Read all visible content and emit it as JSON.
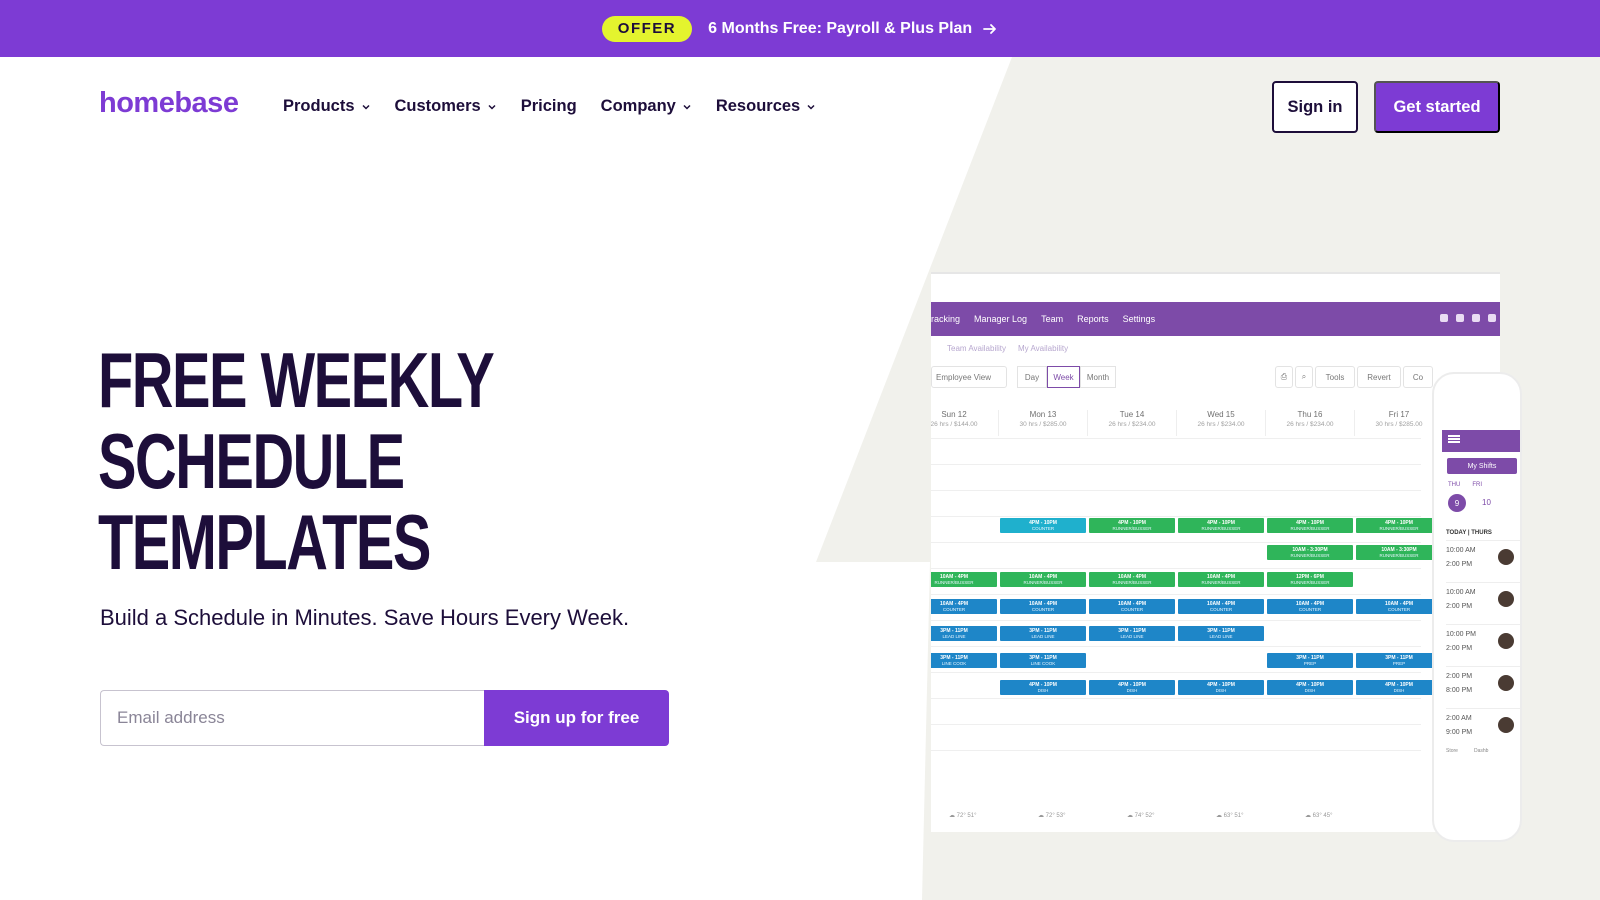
{
  "banner": {
    "offer_label": "OFFER",
    "text": "6 Months Free: Payroll & Plus Plan"
  },
  "nav": {
    "logo": "homebase",
    "items": [
      {
        "label": "Products",
        "dropdown": true
      },
      {
        "label": "Customers",
        "dropdown": true
      },
      {
        "label": "Pricing",
        "dropdown": false
      },
      {
        "label": "Company",
        "dropdown": true
      },
      {
        "label": "Resources",
        "dropdown": true
      }
    ],
    "signin_label": "Sign in",
    "get_started_label": "Get started"
  },
  "hero": {
    "title_lines": [
      "FREE WEEKLY",
      "SCHEDULE",
      "TEMPLATES"
    ],
    "subtitle": "Build a Schedule in Minutes. Save Hours Every Week.",
    "email_placeholder": "Email address",
    "signup_label": "Sign up for free"
  },
  "mock": {
    "app_tabs": [
      "racking",
      "Manager Log",
      "Team",
      "Reports",
      "Settings"
    ],
    "sub_tabs": [
      "Team Availability",
      "My Availability"
    ],
    "view_select": "Employee View",
    "view_buttons": [
      "Day",
      "Week",
      "Month"
    ],
    "toolbar_right": [
      "Tools",
      "Revert",
      "Co"
    ],
    "days": [
      {
        "name": "Sun 12",
        "hrs": "26 hrs / $144.00"
      },
      {
        "name": "Mon 13",
        "hrs": "30 hrs / $285.00"
      },
      {
        "name": "Tue 14",
        "hrs": "26 hrs / $234.00"
      },
      {
        "name": "Wed 15",
        "hrs": "26 hrs / $234.00"
      },
      {
        "name": "Thu 16",
        "hrs": "26 hrs / $234.00"
      },
      {
        "name": "Fri 17",
        "hrs": "30 hrs / $285.00"
      }
    ],
    "shifts": [
      {
        "day": 1,
        "row": 0,
        "color": "teal",
        "time": "4PM - 10PM",
        "role": "COUNTER"
      },
      {
        "day": 2,
        "row": 0,
        "color": "green",
        "time": "4PM - 10PM",
        "role": "RUNNER/BUSSER"
      },
      {
        "day": 3,
        "row": 0,
        "color": "green",
        "time": "4PM - 10PM",
        "role": "RUNNER/BUSSER"
      },
      {
        "day": 4,
        "row": 0,
        "color": "green",
        "time": "4PM - 10PM",
        "role": "RUNNER/BUSSER"
      },
      {
        "day": 5,
        "row": 0,
        "color": "green",
        "time": "4PM - 10PM",
        "role": "RUNNER/BUSSER"
      },
      {
        "day": 4,
        "row": 1,
        "color": "green",
        "time": "10AM - 3:30PM",
        "role": "RUNNER/BUSSER"
      },
      {
        "day": 5,
        "row": 1,
        "color": "green",
        "time": "10AM - 3:30PM",
        "role": "RUNNER/BUSSER"
      },
      {
        "day": 0,
        "row": 2,
        "color": "green",
        "time": "10AM - 4PM",
        "role": "RUNNER/BUSSER"
      },
      {
        "day": 1,
        "row": 2,
        "color": "green",
        "time": "10AM - 4PM",
        "role": "RUNNER/BUSSER"
      },
      {
        "day": 2,
        "row": 2,
        "color": "green",
        "time": "10AM - 4PM",
        "role": "RUNNER/BUSSER"
      },
      {
        "day": 3,
        "row": 2,
        "color": "green",
        "time": "10AM - 4PM",
        "role": "RUNNER/BUSSER"
      },
      {
        "day": 4,
        "row": 2,
        "color": "green",
        "time": "12PM - 6PM",
        "role": "RUNNER/BUSSER"
      },
      {
        "day": 0,
        "row": 3,
        "color": "blue",
        "time": "10AM - 4PM",
        "role": "COUNTER"
      },
      {
        "day": 1,
        "row": 3,
        "color": "blue",
        "time": "10AM - 4PM",
        "role": "COUNTER"
      },
      {
        "day": 2,
        "row": 3,
        "color": "blue",
        "time": "10AM - 4PM",
        "role": "COUNTER"
      },
      {
        "day": 3,
        "row": 3,
        "color": "blue",
        "time": "10AM - 4PM",
        "role": "COUNTER"
      },
      {
        "day": 4,
        "row": 3,
        "color": "blue",
        "time": "10AM - 4PM",
        "role": "COUNTER"
      },
      {
        "day": 5,
        "row": 3,
        "color": "blue",
        "time": "10AM - 4PM",
        "role": "COUNTER"
      },
      {
        "day": 0,
        "row": 4,
        "color": "blue",
        "time": "3PM - 11PM",
        "role": "LEAD LINE"
      },
      {
        "day": 1,
        "row": 4,
        "color": "blue",
        "time": "3PM - 11PM",
        "role": "LEAD LINE"
      },
      {
        "day": 2,
        "row": 4,
        "color": "blue",
        "time": "3PM - 11PM",
        "role": "LEAD LINE"
      },
      {
        "day": 3,
        "row": 4,
        "color": "blue",
        "time": "3PM - 11PM",
        "role": "LEAD LINE"
      },
      {
        "day": 0,
        "row": 5,
        "color": "blue",
        "time": "3PM - 11PM",
        "role": "LINE COOK"
      },
      {
        "day": 1,
        "row": 5,
        "color": "blue",
        "time": "3PM - 11PM",
        "role": "LINE COOK"
      },
      {
        "day": 4,
        "row": 5,
        "color": "blue",
        "time": "3PM - 11PM",
        "role": "PREP"
      },
      {
        "day": 5,
        "row": 5,
        "color": "blue",
        "time": "3PM - 11PM",
        "role": "PREP"
      },
      {
        "day": 1,
        "row": 6,
        "color": "blue",
        "time": "4PM - 10PM",
        "role": "DISH"
      },
      {
        "day": 2,
        "row": 6,
        "color": "blue",
        "time": "4PM - 10PM",
        "role": "DISH"
      },
      {
        "day": 3,
        "row": 6,
        "color": "blue",
        "time": "4PM - 10PM",
        "role": "DISH"
      },
      {
        "day": 4,
        "row": 6,
        "color": "blue",
        "time": "4PM - 10PM",
        "role": "DISH"
      },
      {
        "day": 5,
        "row": 6,
        "color": "blue",
        "time": "4PM - 10PM",
        "role": "DISH"
      }
    ],
    "weather": [
      "72° 51°",
      "72° 53°",
      "74° 52°",
      "63° 51°",
      "63° 45°"
    ],
    "phone": {
      "my_shifts": "My Shifts",
      "days": [
        "THU",
        "FRI"
      ],
      "date_selected": "9",
      "date_next": "10",
      "today_label": "TODAY | THURS",
      "shifts": [
        {
          "start": "10:00 AM",
          "end": "2:00 PM"
        },
        {
          "start": "10:00 AM",
          "end": "2:00 PM"
        },
        {
          "start": "10:00 PM",
          "end": "2:00 PM"
        },
        {
          "start": "2:00 PM",
          "end": "8:00 PM"
        },
        {
          "start": "2:00 AM",
          "end": "9:00 PM"
        }
      ],
      "footer": [
        "Store",
        "Dashb"
      ]
    }
  },
  "colors": {
    "brand": "#7d3bd4",
    "ink": "#1d0e3a",
    "offer": "#e4f42e",
    "panel": "#f1f1ec"
  }
}
